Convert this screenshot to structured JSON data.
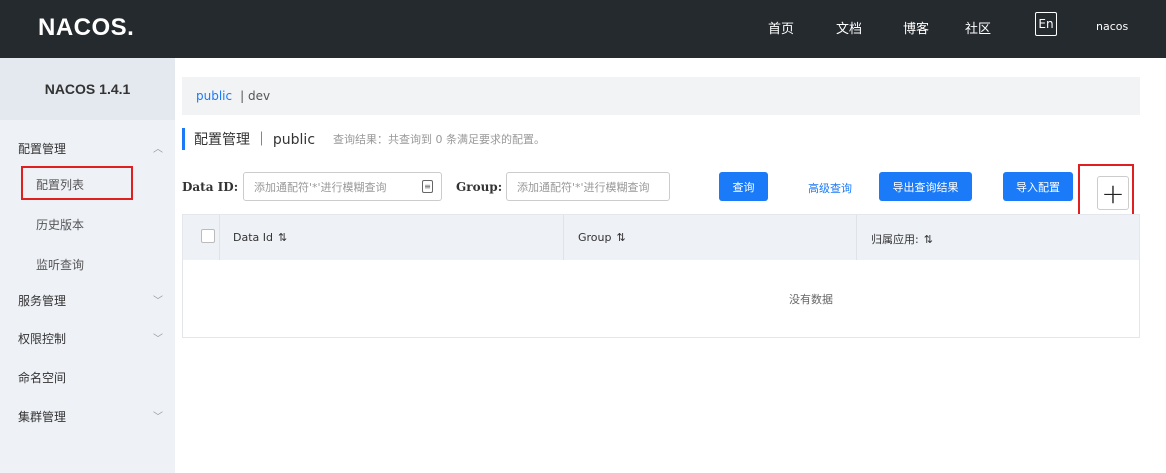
{
  "header": {
    "logo": "NACOS.",
    "nav": [
      "首页",
      "文档",
      "博客",
      "社区"
    ],
    "lang": "En",
    "user": "nacos"
  },
  "sidebar": {
    "version": "NACOS 1.4.1",
    "items": [
      {
        "label": "配置管理",
        "expanded": true
      },
      {
        "label": "配置列表"
      },
      {
        "label": "历史版本"
      },
      {
        "label": "监听查询"
      },
      {
        "label": "服务管理"
      },
      {
        "label": "权限控制"
      },
      {
        "label": "命名空间"
      },
      {
        "label": "集群管理"
      }
    ]
  },
  "breadcrumb": {
    "active": "public",
    "other": "| dev"
  },
  "page": {
    "title": "配置管理 ｜ public",
    "subtitle": "查询结果：共查询到 0 条满足要求的配置。"
  },
  "search": {
    "data_id_label": "Data ID:",
    "data_id_placeholder": "添加通配符'*'进行模糊查询",
    "group_label": "Group:",
    "group_placeholder": "添加通配符'*'进行模糊查询",
    "query_button": "查询",
    "advanced_link": "高级查询",
    "export_button": "导出查询结果",
    "import_button": "导入配置",
    "add_button": "+"
  },
  "table": {
    "columns": [
      "Data Id",
      "Group",
      "归属应用:"
    ],
    "sort_glyph": "⇅",
    "empty_text": "没有数据"
  },
  "colors": {
    "topbar": "#252a2f",
    "accent": "#1a7af8",
    "highlight": "#e02020"
  }
}
